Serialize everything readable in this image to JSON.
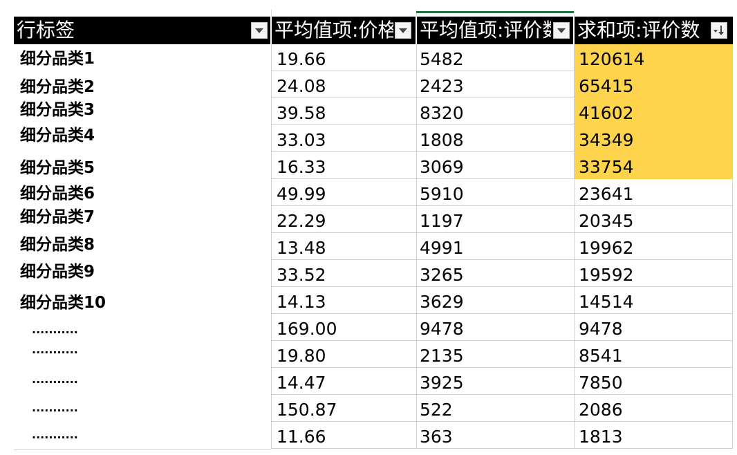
{
  "header": {
    "row_label": "行标签",
    "col_a": "平均值项:价格",
    "col_b": "平均值项:评价数",
    "col_c": "求和项:评价数"
  },
  "colors": {
    "header_bg": "#000000",
    "highlight": "#ffd44d",
    "selection": "#217346"
  },
  "rows": [
    {
      "label": "细分品类1",
      "a": "19.66",
      "b": "5482",
      "c": "120614",
      "highlight": true
    },
    {
      "label": "细分品类2",
      "a": "24.08",
      "b": "2423",
      "c": "65415",
      "highlight": true
    },
    {
      "label": "细分品类3",
      "a": "39.58",
      "b": "8320",
      "c": "41602",
      "highlight": true
    },
    {
      "label": "细分品类4",
      "a": "33.03",
      "b": "1808",
      "c": "34349",
      "highlight": true
    },
    {
      "label": "细分品类5",
      "a": "16.33",
      "b": "3069",
      "c": "33754",
      "highlight": true
    },
    {
      "label": "细分品类6",
      "a": "49.99",
      "b": "5910",
      "c": "23641",
      "highlight": false
    },
    {
      "label": "细分品类7",
      "a": "22.29",
      "b": "1197",
      "c": "20345",
      "highlight": false
    },
    {
      "label": "细分品类8",
      "a": "13.48",
      "b": "4991",
      "c": "19962",
      "highlight": false
    },
    {
      "label": "细分品类9",
      "a": "33.52",
      "b": "3265",
      "c": "19592",
      "highlight": false
    },
    {
      "label": "细分品类10",
      "a": "14.13",
      "b": "3629",
      "c": "14514",
      "highlight": false
    },
    {
      "label": "...........",
      "a": "169.00",
      "b": "9478",
      "c": "9478",
      "highlight": false
    },
    {
      "label": "...........",
      "a": "19.80",
      "b": "2135",
      "c": "8541",
      "highlight": false
    },
    {
      "label": "...........",
      "a": "14.47",
      "b": "3925",
      "c": "7850",
      "highlight": false
    },
    {
      "label": "...........",
      "a": "150.87",
      "b": "522",
      "c": "2086",
      "highlight": false
    },
    {
      "label": "...........",
      "a": "11.66",
      "b": "363",
      "c": "1813",
      "highlight": false
    }
  ]
}
